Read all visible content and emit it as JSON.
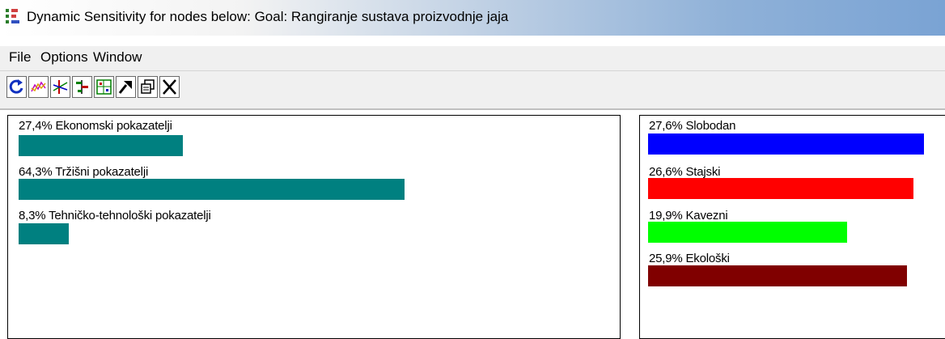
{
  "window": {
    "title": "Dynamic Sensitivity for nodes below: Goal: Rangiranje sustava proizvodnje jaja"
  },
  "menu": {
    "items": [
      {
        "label": "File"
      },
      {
        "label": "Options"
      },
      {
        "label": "Window"
      }
    ]
  },
  "toolbar": {
    "buttons": [
      {
        "icon": "recalculate-icon"
      },
      {
        "icon": "performance-graph-icon"
      },
      {
        "icon": "gradient-icon"
      },
      {
        "icon": "head-to-head-icon"
      },
      {
        "icon": "two-d-plot-icon"
      },
      {
        "icon": "arrow-icon"
      },
      {
        "icon": "copy-icon"
      },
      {
        "icon": "close-icon"
      }
    ]
  },
  "criteria": {
    "items": [
      {
        "label": "27,4% Ekonomski pokazatelji",
        "value": 27.4,
        "color": "#008080"
      },
      {
        "label": "64,3% Tržišni pokazatelji",
        "value": 64.3,
        "color": "#008080"
      },
      {
        "label": "8,3% Tehničko-tehnološki pokazatelji",
        "value": 8.3,
        "color": "#008080"
      }
    ]
  },
  "alternatives": {
    "items": [
      {
        "label": "27,6% Slobodan",
        "value": 27.6,
        "color": "#0000ff"
      },
      {
        "label": "26,6% Stajski",
        "value": 26.6,
        "color": "#ff0000"
      },
      {
        "label": "19,9% Kavezni",
        "value": 19.9,
        "color": "#00ff00"
      },
      {
        "label": "25,9% Ekološki",
        "value": 25.9,
        "color": "#800000"
      }
    ]
  }
}
